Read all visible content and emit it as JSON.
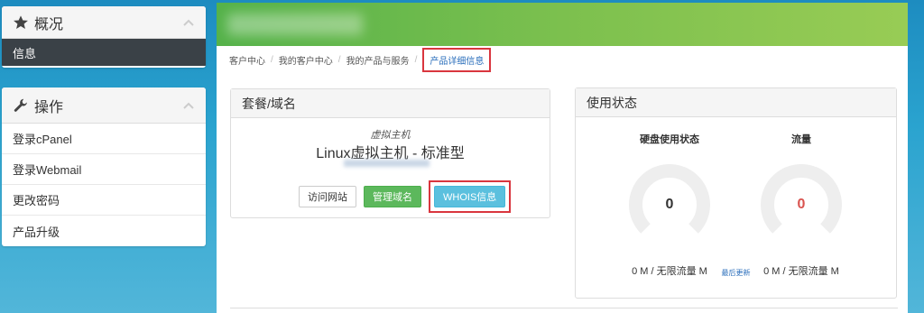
{
  "sidebar": {
    "overview": {
      "title": "概况",
      "items": [
        {
          "label": "信息"
        }
      ]
    },
    "actions": {
      "title": "操作",
      "items": [
        {
          "label": "登录cPanel"
        },
        {
          "label": "登录Webmail"
        },
        {
          "label": "更改密码"
        },
        {
          "label": "产品升级"
        }
      ]
    }
  },
  "breadcrumb": {
    "items": [
      "客户中心",
      "我的客户中心",
      "我的产品与服务"
    ],
    "active": "产品详细信息"
  },
  "product": {
    "panel_title": "套餐/域名",
    "type": "虚拟主机",
    "name": "Linux虚拟主机 - 标准型",
    "buttons": {
      "visit": "访问网站",
      "manage": "管理域名",
      "whois": "WHOIS信息"
    }
  },
  "usage": {
    "panel_title": "使用状态",
    "disk": {
      "title": "硬盘使用状态",
      "value": "0",
      "text": "0 M / 无限流量 M"
    },
    "traffic": {
      "title": "流量",
      "value": "0",
      "text": "0 M / 无限流量 M"
    },
    "last_update": "最后更新"
  },
  "colors": {
    "header_green": "#7cc04e",
    "active_sidebar": "#3a4147",
    "highlight_red": "#d9363e",
    "link_blue": "#2a6ebb",
    "traffic_value": "#d9534f",
    "disk_value": "#333333"
  }
}
